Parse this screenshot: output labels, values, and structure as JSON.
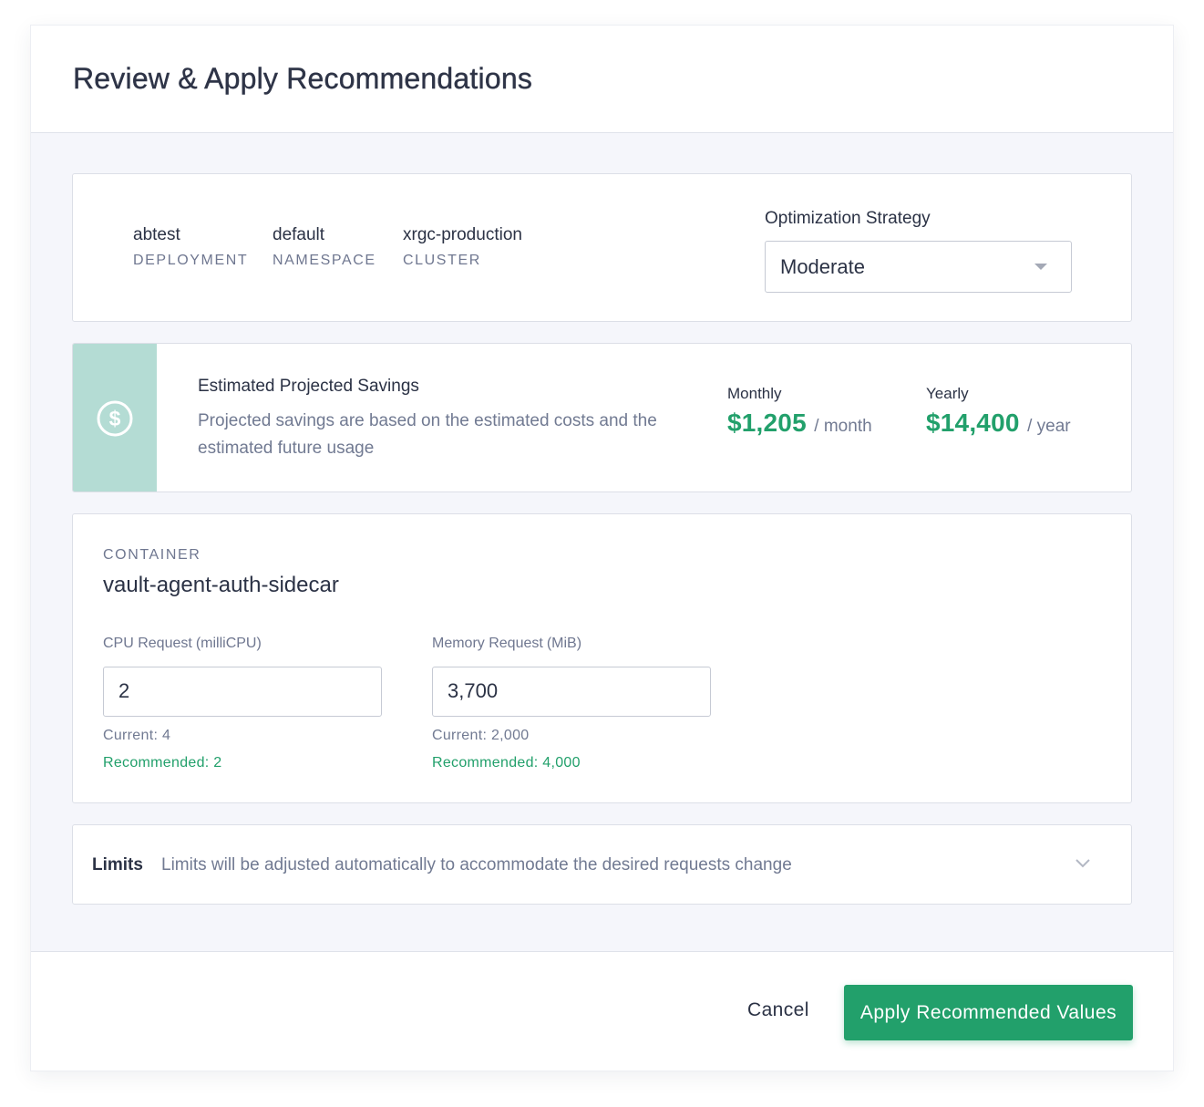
{
  "dialog": {
    "title": "Review & Apply Recommendations"
  },
  "workload": {
    "deployment": {
      "value": "abtest",
      "label": "DEPLOYMENT"
    },
    "namespace": {
      "value": "default",
      "label": "NAMESPACE"
    },
    "cluster": {
      "value": "xrgc-production",
      "label": "CLUSTER"
    }
  },
  "strategy": {
    "label": "Optimization Strategy",
    "selected": "Moderate"
  },
  "savings": {
    "icon": "dollar-circle-icon",
    "title": "Estimated Projected Savings",
    "description": "Projected savings are based on the estimated costs and the estimated future usage",
    "monthly": {
      "label": "Monthly",
      "amount": "$1,205",
      "unit": "/ month"
    },
    "yearly": {
      "label": "Yearly",
      "amount": "$14,400",
      "unit": "/ year"
    }
  },
  "container": {
    "label": "CONTAINER",
    "name": "vault-agent-auth-sidecar",
    "cpu": {
      "label": "CPU Request",
      "unit": "(milliCPU)",
      "value": "2",
      "current": "Current: 4",
      "recommended": "Recommended: 2"
    },
    "memory": {
      "label": "Memory Request",
      "unit": "(MiB)",
      "value": "3,700",
      "current": "Current: 2,000",
      "recommended": "Recommended: 4,000"
    }
  },
  "limits": {
    "title": "Limits",
    "description": "Limits will be adjusted automatically to accommodate the desired requests change",
    "icon": "chevron-down-icon"
  },
  "footer": {
    "cancel": "Cancel",
    "apply": "Apply Recommended Values"
  },
  "colors": {
    "accent": "#22a06b",
    "savings_side": "#b4dcd4",
    "text": "#2b3245",
    "muted": "#717a92"
  }
}
